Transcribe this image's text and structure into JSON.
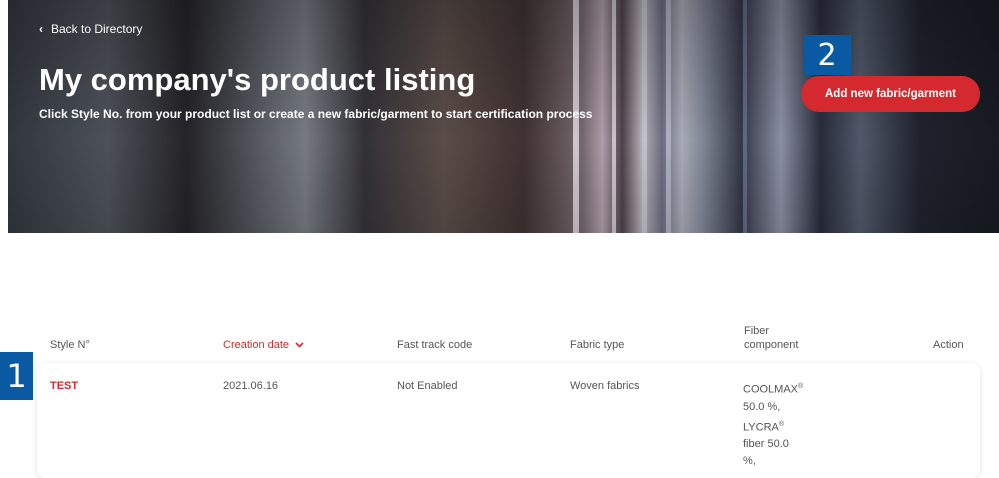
{
  "hero": {
    "back_label": "Back to Directory",
    "title": "My company's product listing",
    "subtitle": "Click Style No. from your product list or create a new fabric/garment to start certification process",
    "add_button": "Add new fabric/garment"
  },
  "markers": {
    "one": "1",
    "two": "2"
  },
  "table": {
    "headers": {
      "style_no": "Style N°",
      "creation_date": "Creation date",
      "fast_track": "Fast track code",
      "fabric_type": "Fabric type",
      "fiber_line1": "Fiber",
      "fiber_line2": "component",
      "action": "Action"
    },
    "rows": [
      {
        "style_no": "TEST",
        "creation_date": "2021.06.16",
        "fast_track": "Not Enabled",
        "fabric_type": "Woven fabrics",
        "fiber": {
          "line1": "COOLMAX",
          "line2": "50.0 %,",
          "line3": "LYCRA",
          "line4": "fiber 50.0",
          "line5": "%,",
          "reg_mark": "®"
        }
      }
    ]
  },
  "colors": {
    "accent": "#d42a2f",
    "marker": "#0a5aa3"
  }
}
